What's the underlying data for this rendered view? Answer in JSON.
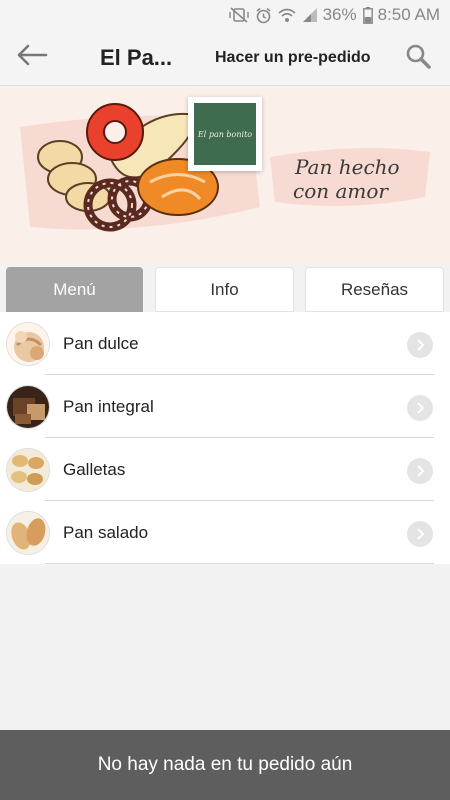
{
  "status_bar": {
    "battery_percent": "36%",
    "time": "8:50 AM",
    "icons": [
      "mute-vibrate-icon",
      "alarm-icon",
      "wifi-icon",
      "signal-icon",
      "battery-icon"
    ]
  },
  "app_bar": {
    "title": "El Pa...",
    "preorder_label": "Hacer un pre-pedido",
    "icons": [
      "back-arrow-icon",
      "search-icon"
    ]
  },
  "banner": {
    "logo_text": "El pan bonito",
    "tagline_line1": "Pan hecho",
    "tagline_line2": "con amor"
  },
  "tabs": [
    {
      "label": "Menú",
      "active": true
    },
    {
      "label": "Info",
      "active": false
    },
    {
      "label": "Reseñas",
      "active": false
    }
  ],
  "menu": {
    "items": [
      {
        "label": "Pan dulce",
        "icon": "pan-dulce-thumbnail"
      },
      {
        "label": "Pan integral",
        "icon": "pan-integral-thumbnail"
      },
      {
        "label": "Galletas",
        "icon": "galletas-thumbnail"
      },
      {
        "label": "Pan salado",
        "icon": "pan-salado-thumbnail"
      }
    ]
  },
  "order_bar": {
    "text": "No hay nada en tu pedido aún"
  },
  "colors": {
    "active_tab": "#a3a3a3",
    "order_bar": "#5e5e5e",
    "logo_green": "#3f6b4f",
    "banner_bg": "#fbefe9"
  }
}
